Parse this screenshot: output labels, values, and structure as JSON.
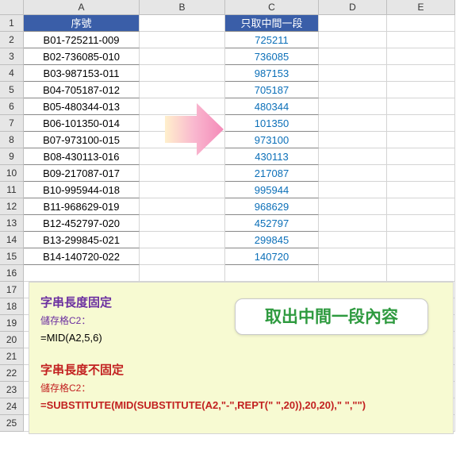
{
  "columns": [
    "A",
    "B",
    "C",
    "D",
    "E"
  ],
  "row_nums": [
    1,
    2,
    3,
    4,
    5,
    6,
    7,
    8,
    9,
    10,
    11,
    12,
    13,
    14,
    15,
    16,
    17,
    18,
    19,
    20,
    21,
    22,
    23,
    24,
    25
  ],
  "headers": {
    "A": "序號",
    "C": "只取中間一段"
  },
  "rows": [
    {
      "seq": "B01-725211-009",
      "mid": "725211"
    },
    {
      "seq": "B02-736085-010",
      "mid": "736085"
    },
    {
      "seq": "B03-987153-011",
      "mid": "987153"
    },
    {
      "seq": "B04-705187-012",
      "mid": "705187"
    },
    {
      "seq": "B05-480344-013",
      "mid": "480344"
    },
    {
      "seq": "B06-101350-014",
      "mid": "101350"
    },
    {
      "seq": "B07-973100-015",
      "mid": "973100"
    },
    {
      "seq": "B08-430113-016",
      "mid": "430113"
    },
    {
      "seq": "B09-217087-017",
      "mid": "217087"
    },
    {
      "seq": "B10-995944-018",
      "mid": "995944"
    },
    {
      "seq": "B11-968629-019",
      "mid": "968629"
    },
    {
      "seq": "B12-452797-020",
      "mid": "452797"
    },
    {
      "seq": "B13-299845-021",
      "mid": "299845"
    },
    {
      "seq": "B14-140720-022",
      "mid": "140720"
    }
  ],
  "note": {
    "sec1_title": "字串長度固定",
    "sec1_sub": "儲存格C2：",
    "sec1_formula": "=MID(A2,5,6)",
    "sec2_title": "字串長度不固定",
    "sec2_sub": "儲存格C2：",
    "sec2_formula": "=SUBSTITUTE(MID(SUBSTITUTE(A2,\"-\",REPT(\" \",20)),20,20),\" \",\"\")"
  },
  "callout": "取出中間一段內容"
}
